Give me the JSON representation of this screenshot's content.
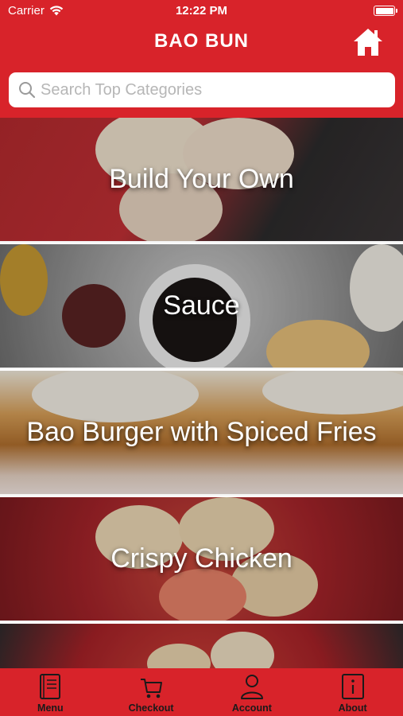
{
  "status_bar": {
    "carrier": "Carrier",
    "time": "12:22 PM"
  },
  "header": {
    "title": "BAO BUN",
    "home_icon": "home-icon"
  },
  "search": {
    "placeholder": "Search Top Categories",
    "value": ""
  },
  "categories": [
    {
      "label": "Build Your Own"
    },
    {
      "label": "Sauce"
    },
    {
      "label": "Bao Burger with Spiced Fries"
    },
    {
      "label": "Crispy Chicken"
    },
    {
      "label": ""
    }
  ],
  "tabbar": {
    "items": [
      {
        "label": "Menu",
        "icon": "menu-book-icon"
      },
      {
        "label": "Checkout",
        "icon": "cart-icon"
      },
      {
        "label": "Account",
        "icon": "user-icon"
      },
      {
        "label": "About",
        "icon": "info-icon"
      }
    ]
  },
  "colors": {
    "brand": "#d8232a",
    "text_on_brand": "#ffffff"
  }
}
